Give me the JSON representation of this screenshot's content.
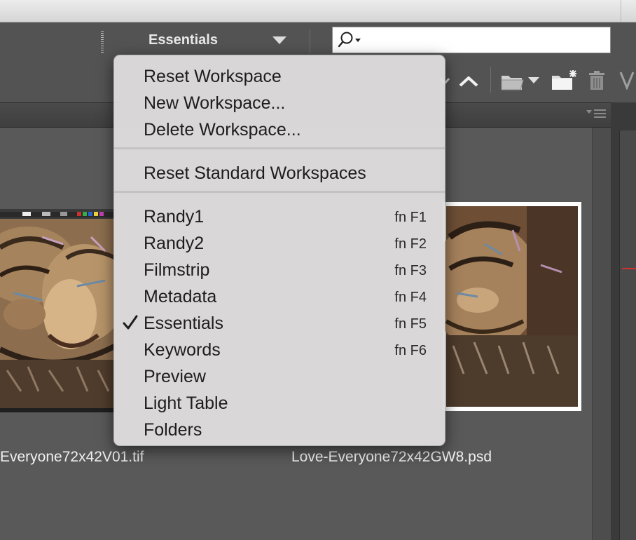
{
  "header": {
    "workspace_label": "Essentials"
  },
  "search": {
    "placeholder": ""
  },
  "menu": {
    "groups": [
      [
        {
          "label": "Reset Workspace"
        },
        {
          "label": "New Workspace..."
        },
        {
          "label": "Delete Workspace..."
        }
      ],
      [
        {
          "label": "Reset Standard Workspaces"
        }
      ],
      [
        {
          "label": "Randy1",
          "shortcut": "fn F1"
        },
        {
          "label": "Randy2",
          "shortcut": "fn F2"
        },
        {
          "label": "Filmstrip",
          "shortcut": "fn F3"
        },
        {
          "label": "Metadata",
          "shortcut": "fn F4"
        },
        {
          "label": "Essentials",
          "shortcut": "fn F5",
          "checked": true
        },
        {
          "label": "Keywords",
          "shortcut": "fn F6"
        },
        {
          "label": "Preview"
        },
        {
          "label": "Light Table"
        },
        {
          "label": "Folders"
        }
      ]
    ]
  },
  "content": {
    "files": [
      {
        "name": "Everyone72x42V01.tif"
      },
      {
        "name": "Love-Everyone72x42GW8.psd"
      }
    ]
  },
  "icons": {
    "search": "search-icon",
    "chevron_up": "chevron-up-icon",
    "folder": "folder-icon",
    "new_folder": "new-folder-icon",
    "trash": "trash-icon",
    "check": "checkmark-icon",
    "panel_menu": "panel-menu-icon"
  },
  "colors": {
    "chrome": "#535353",
    "content": "#595959",
    "menu": "#dddbdb"
  }
}
